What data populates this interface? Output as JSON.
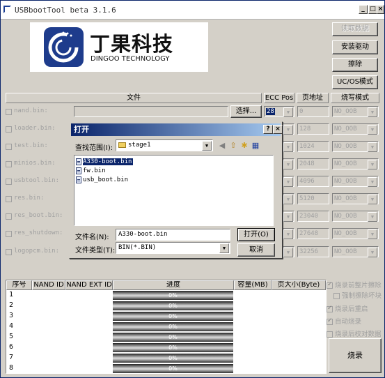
{
  "window": {
    "title": "USBbootTool beta 3.1.6",
    "min": "_",
    "max": "□",
    "close": "×"
  },
  "logo": {
    "cn": "丁果科技",
    "en": "DINGOO TECHNOLOGY"
  },
  "buttons": {
    "read": "读取数据",
    "install": "安装驱动",
    "erase": "擦除",
    "ucos": "UC/OS模式",
    "burn": "烧录"
  },
  "headers": {
    "file": "文件",
    "ecc": "ECC Pos",
    "page": "页地址",
    "mode": "烧写模式"
  },
  "files": [
    {
      "label": "nand.bin:",
      "ecc": "28",
      "page": "0",
      "mode": "NO_OOB"
    },
    {
      "label": "loader.bin:",
      "ecc": "",
      "page": "128",
      "mode": "NO_OOB"
    },
    {
      "label": "test.bin:",
      "ecc": "",
      "page": "1024",
      "mode": "NO_OOB"
    },
    {
      "label": "minios.bin:",
      "ecc": "",
      "page": "2048",
      "mode": "NO_OOB"
    },
    {
      "label": "usbtool.bin:",
      "ecc": "",
      "page": "4096",
      "mode": "NO_OOB"
    },
    {
      "label": "res.bin:",
      "ecc": "",
      "page": "5120",
      "mode": "NO_OOB"
    },
    {
      "label": "res_boot.bin:",
      "ecc": "",
      "page": "23040",
      "mode": "NO_OOB"
    },
    {
      "label": "res_shutdown:",
      "ecc": "",
      "page": "27648",
      "mode": "NO_OOB"
    },
    {
      "label": "logopcm.bin:",
      "ecc": "",
      "page": "32256",
      "mode": "NO_OOB"
    }
  ],
  "select_button": "选择...",
  "table": {
    "cols": [
      "序号",
      "NAND ID",
      "NAND EXT ID",
      "进度",
      "容量(MB)",
      "页大小(Byte)"
    ],
    "rows": [
      {
        "n": "1",
        "p": "0%"
      },
      {
        "n": "2",
        "p": "0%"
      },
      {
        "n": "3",
        "p": "0%"
      },
      {
        "n": "4",
        "p": "0%"
      },
      {
        "n": "5",
        "p": "0%"
      },
      {
        "n": "6",
        "p": "0%"
      },
      {
        "n": "7",
        "p": "0%"
      },
      {
        "n": "8",
        "p": "0%"
      }
    ]
  },
  "options": [
    {
      "label": "烧录前整片擦除",
      "checked": true
    },
    {
      "label": "强制擦除坏块",
      "checked": false
    },
    {
      "label": "烧录后重启",
      "checked": true
    },
    {
      "label": "自动烧录",
      "checked": true
    },
    {
      "label": "烧录后校对数据",
      "checked": false
    }
  ],
  "dialog": {
    "title": "打开",
    "help": "?",
    "close": "×",
    "lookin_label": "查找范围(I):",
    "lookin_value": "stage1",
    "files": [
      "A330-boot.bin",
      "fw.bin",
      "usb_boot.bin"
    ],
    "filename_label": "文件名(N):",
    "filename_value": "A330-boot.bin",
    "filetype_label": "文件类型(T):",
    "filetype_value": "BIN(*.BIN)",
    "open": "打开(O)",
    "cancel": "取消"
  }
}
